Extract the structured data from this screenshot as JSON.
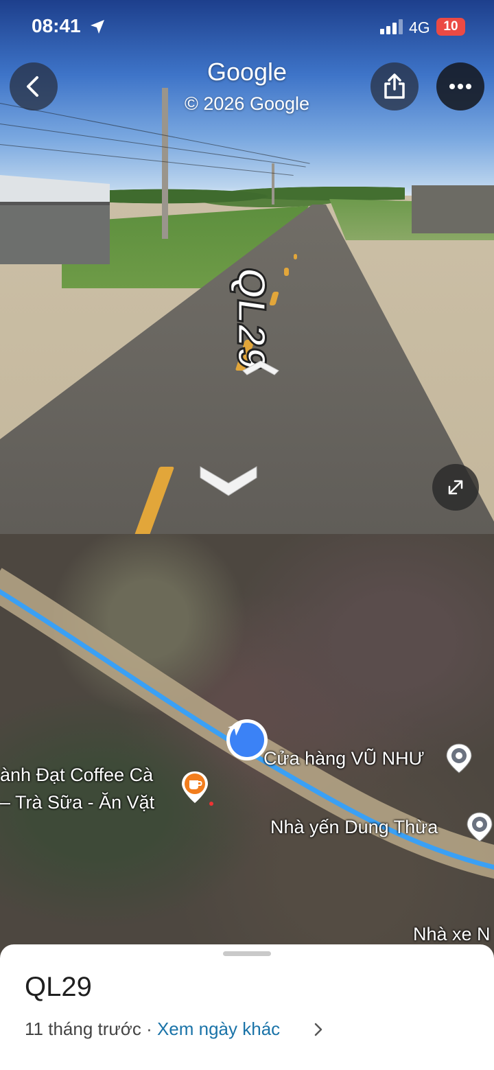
{
  "status_bar": {
    "time": "08:41",
    "network": "4G",
    "battery": "10"
  },
  "street_view": {
    "watermark_title": "Google",
    "watermark_copyright": "© 2026 Google",
    "road_marking": "QL29",
    "icons": {
      "back": "chevron-left-icon",
      "share": "share-icon",
      "more": "more-horizontal-icon",
      "expand": "expand-icon",
      "location": "location-arrow-icon"
    }
  },
  "map": {
    "places": [
      {
        "label": "Cửa hàng VŨ NHƯ",
        "icon": "location-pin-icon"
      },
      {
        "label": "ành Đạt Coffee Cà",
        "icon": "coffee-pin-icon"
      },
      {
        "label": "– Trà Sữa - Ăn Vặt"
      },
      {
        "label": "Nhà yến Dung Thừa",
        "icon": "location-pin-icon"
      },
      {
        "label": "Nhà xe N"
      }
    ],
    "colors": {
      "route": "#3aa0f5",
      "road": "#b8a888",
      "pegman": "#3b82f6",
      "coffee_pin": "#f27d1d"
    }
  },
  "sheet": {
    "title": "QL29",
    "age": "11 tháng trước",
    "separator": " · ",
    "link": "Xem ngày khác"
  }
}
